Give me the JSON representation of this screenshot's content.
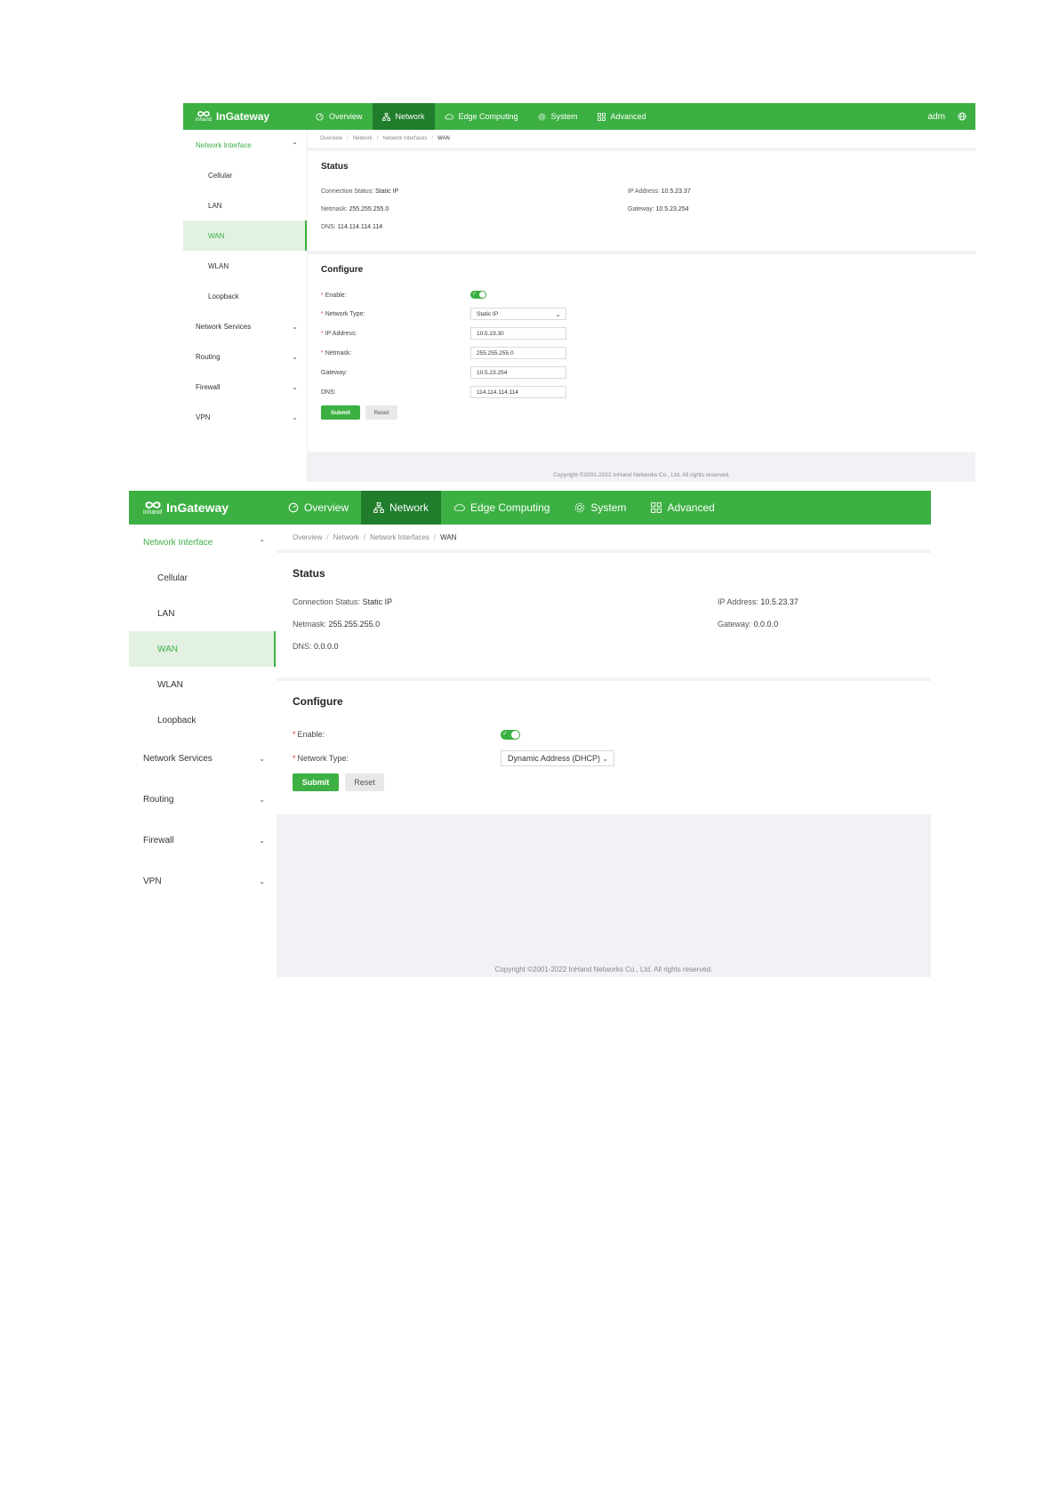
{
  "common": {
    "brand_small": "inhand",
    "brand": "InGateway",
    "nav": [
      {
        "label": "Overview",
        "icon": "dashboard-icon"
      },
      {
        "label": "Network",
        "icon": "network-icon"
      },
      {
        "label": "Edge Computing",
        "icon": "cloud-icon"
      },
      {
        "label": "System",
        "icon": "gear-icon"
      },
      {
        "label": "Advanced",
        "icon": "grid-icon"
      }
    ],
    "active_nav": "Network",
    "sidebar": {
      "group_open": "Network Interface",
      "sub_items": [
        "Cellular",
        "LAN",
        "WAN",
        "WLAN",
        "Loopback"
      ],
      "selected": "WAN",
      "groups_closed": [
        "Network Services",
        "Routing",
        "Firewall",
        "VPN"
      ]
    },
    "breadcrumb": [
      "Overview",
      "Network",
      "Network Interfaces",
      "WAN"
    ],
    "status_title": "Status",
    "configure_title": "Configure",
    "labels": {
      "connection_status": "Connection Status:",
      "ip_address": "IP Address:",
      "netmask": "Netmask:",
      "gateway": "Gateway:",
      "dns": "DNS:",
      "enable": "Enable:",
      "network_type": "Network Type:",
      "ip_address_field": "IP Address:",
      "netmask_field": "Netmask:",
      "gateway_field": "Gateway:",
      "dns_field": "DNS:"
    },
    "submit_label": "Submit",
    "reset_label": "Reset",
    "copyright": "Copyright ©2001-2022 InHand Networks Co., Ltd. All rights reserved.",
    "colors": {
      "primary": "#3cb043",
      "active_nav": "#1f7d2c",
      "selected_bg": "#e3f1e3",
      "content_bg": "#f0f2f5"
    }
  },
  "shot1": {
    "user": "adm",
    "status": {
      "connection_status": "Static IP",
      "ip_address": "10.5.23.37",
      "netmask": "255.255.255.0",
      "gateway": "10.5.23.254",
      "dns": "114.114.114.114"
    },
    "config": {
      "enabled": true,
      "network_type": "Static IP",
      "ip_address": "10.5.23.30",
      "netmask": "255.255.255.0",
      "gateway": "10.5.23.254",
      "dns": "114.114.114.114"
    }
  },
  "shot2": {
    "status": {
      "connection_status": "Static IP",
      "ip_address": "10.5.23.37",
      "netmask": "255.255.255.0",
      "gateway": "0.0.0.0",
      "dns": "0.0.0.0"
    },
    "config": {
      "enabled": true,
      "network_type": "Dynamic Address (DHCP)"
    }
  }
}
